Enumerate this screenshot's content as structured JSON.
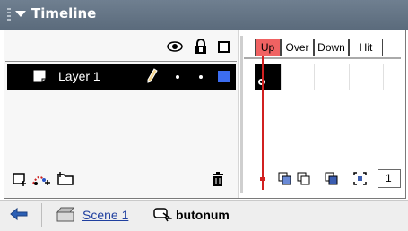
{
  "panel": {
    "title": "Timeline"
  },
  "layers": [
    {
      "name": "Layer 1",
      "color": "#3c6df0"
    }
  ],
  "frames": {
    "labels": [
      "Up",
      "Over",
      "Down",
      "Hit"
    ],
    "current_frame": "1"
  },
  "breadcrumb": {
    "scene": "Scene 1",
    "symbol": "butonum"
  },
  "icons": {
    "header": [
      "eye-icon",
      "lock-icon",
      "outline-icon"
    ],
    "layer_row": [
      "layer-doc-icon",
      "pencil-icon"
    ],
    "left_toolbar": [
      "insert-layer-icon",
      "motion-guide-icon",
      "insert-folder-icon",
      "trash-icon"
    ],
    "right_toolbar": [
      "center-frame-icon",
      "onion-skin-icon",
      "onion-outline-icon",
      "edit-multiple-icon",
      "onion-markers-icon"
    ]
  },
  "colors": {
    "titlebar": "#5b6b7c",
    "up_frame": "#f06262",
    "playhead": "#d12020"
  }
}
